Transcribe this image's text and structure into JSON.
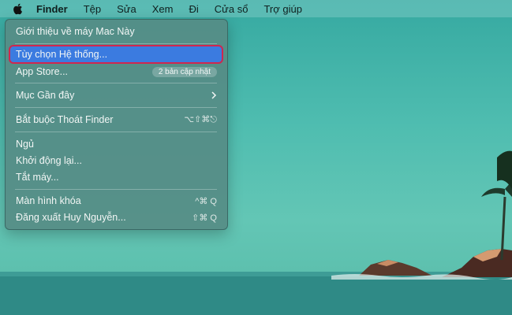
{
  "menubar": {
    "apple": "apple-icon",
    "items": [
      "Finder",
      "Tệp",
      "Sửa",
      "Xem",
      "Đi",
      "Cửa sổ",
      "Trợ giúp"
    ]
  },
  "menu": {
    "about": "Giới thiệu về máy Mac Này",
    "system_prefs": "Tùy chọn Hệ thống...",
    "app_store": "App Store...",
    "app_store_badge": "2 bản cập nhật",
    "recent_items": "Mục Gần đây",
    "force_quit": "Bắt buộc Thoát Finder",
    "force_quit_shortcut": "⌥⇧⌘⎋",
    "sleep": "Ngủ",
    "restart": "Khởi động lại...",
    "shutdown": "Tắt máy...",
    "lock_screen": "Màn hình khóa",
    "lock_shortcut": "^⌘ Q",
    "logout": "Đăng xuất Huy Nguyễn...",
    "logout_shortcut": "⇧⌘ Q"
  },
  "colors": {
    "selection": "#3b7be0",
    "highlight_border": "#d0264f"
  }
}
